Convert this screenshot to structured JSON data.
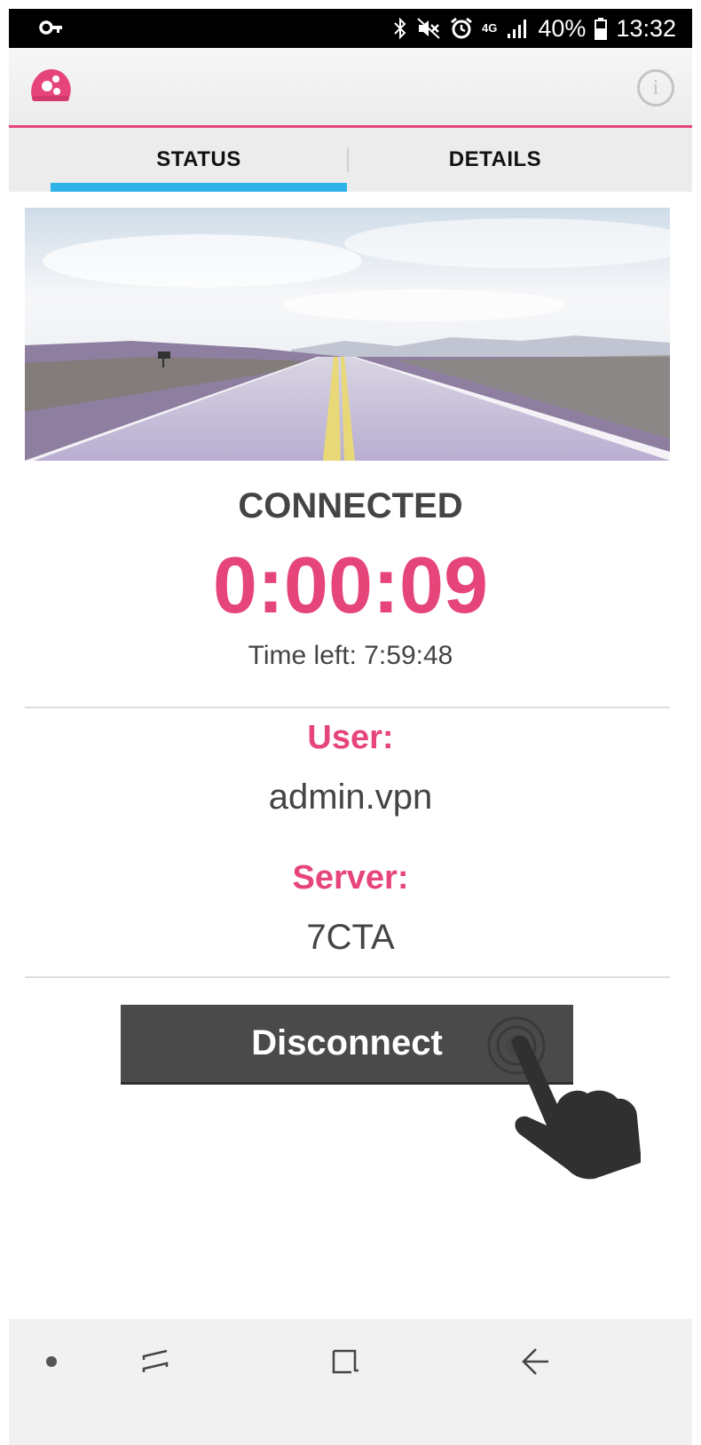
{
  "status_bar": {
    "time": "13:32",
    "battery": "40%",
    "network": "4G",
    "icons": [
      "vpn-key-icon",
      "bluetooth-icon",
      "mute-icon",
      "alarm-icon",
      "4g-icon",
      "signal-icon",
      "battery-icon"
    ]
  },
  "toolbar": {
    "logo_icon": "app-logo-icon",
    "info_label": "i"
  },
  "tabs": [
    {
      "label": "STATUS",
      "active": true
    },
    {
      "label": "DETAILS",
      "active": false
    }
  ],
  "status": {
    "state": "CONNECTED",
    "elapsed": "0:00:09",
    "time_left_label": "Time left: ",
    "time_left_value": "7:59:48"
  },
  "info": {
    "user_label": "User:",
    "user_value": "admin.vpn",
    "server_label": "Server:",
    "server_value": "7CTA"
  },
  "actions": {
    "disconnect_label": "Disconnect"
  },
  "colors": {
    "accent": "#e6457a",
    "tab_indicator": "#2db3e8",
    "button": "#4a4a4a",
    "text": "#444444"
  },
  "nav": {
    "icons": [
      "dot-icon",
      "recents-icon",
      "home-icon",
      "back-icon"
    ]
  }
}
